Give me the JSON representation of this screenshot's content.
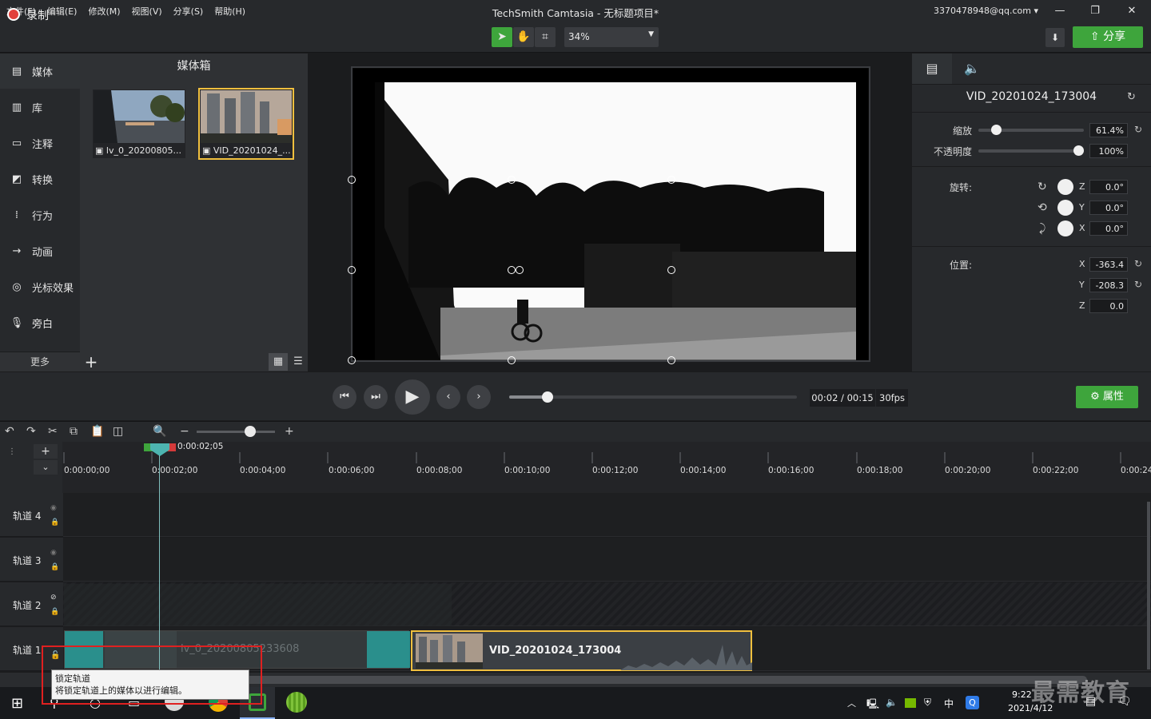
{
  "menu": {
    "items": [
      "文件(F)",
      "编辑(E)",
      "修改(M)",
      "视图(V)",
      "分享(S)",
      "帮助(H)"
    ]
  },
  "window": {
    "title": "TechSmith Camtasia - 无标题项目*",
    "account": "3370478948@qq.com"
  },
  "toolbar": {
    "record_label": "录制",
    "zoom_value": "34%",
    "share_label": "分享"
  },
  "sidebar": {
    "items": [
      {
        "label": "媒体",
        "icon": "film-icon"
      },
      {
        "label": "库",
        "icon": "library-icon"
      },
      {
        "label": "注释",
        "icon": "annotation-icon"
      },
      {
        "label": "转换",
        "icon": "transition-icon"
      },
      {
        "label": "行为",
        "icon": "behavior-icon"
      },
      {
        "label": "动画",
        "icon": "animation-icon"
      },
      {
        "label": "光标效果",
        "icon": "cursor-icon"
      },
      {
        "label": "旁白",
        "icon": "microphone-icon"
      }
    ],
    "more_label": "更多"
  },
  "mediabin": {
    "title": "媒体箱",
    "items": [
      {
        "label": "lv_0_20200805..."
      },
      {
        "label": "VID_20201024_..."
      }
    ]
  },
  "properties": {
    "title": "VID_20201024_173004",
    "scale_label": "缩放",
    "scale_value": "61.4%",
    "scale_fraction": 0.614,
    "opacity_label": "不透明度",
    "opacity_value": "100%",
    "opacity_fraction": 1.0,
    "rotation_label": "旋转:",
    "rotation": [
      {
        "axis": "Z",
        "value": "0.0°"
      },
      {
        "axis": "Y",
        "value": "0.0°"
      },
      {
        "axis": "X",
        "value": "0.0°"
      }
    ],
    "position_label": "位置:",
    "position": [
      {
        "axis": "X",
        "value": "-363.4"
      },
      {
        "axis": "Y",
        "value": "-208.3"
      },
      {
        "axis": "Z",
        "value": "0.0"
      }
    ],
    "button_label": "属性"
  },
  "player": {
    "timecode": "00:02 / 00:15",
    "fps": "30fps",
    "progress_fraction": 0.133
  },
  "timeline": {
    "playhead_time": "0:00:02;05",
    "ticks": [
      "0:00:00;00",
      "0:00:02;00",
      "0:00:04;00",
      "0:00:06;00",
      "0:00:08;00",
      "0:00:10;00",
      "0:00:12;00",
      "0:00:14;00",
      "0:00:16;00",
      "0:00:18;00",
      "0:00:20;00",
      "0:00:22;00",
      "0:00:24"
    ],
    "tracks": [
      "轨道 4",
      "轨道 3",
      "轨道 2",
      "轨道 1"
    ],
    "clips": [
      {
        "label": "lv_0_20200805233608"
      },
      {
        "label": "VID_20201024_173004"
      }
    ]
  },
  "tooltip": {
    "title": "锁定轨道",
    "body": "将锁定轨道上的媒体以进行编辑。"
  },
  "taskbar": {
    "time": "9:22",
    "date": "2021/4/12",
    "ime": "中"
  },
  "watermark": "最需教育",
  "colors": {
    "accent_green": "#3ea53c",
    "record_red": "#e2403b",
    "selection_yellow": "#f0bf3e",
    "clip_teal": "#2a8f8c"
  }
}
